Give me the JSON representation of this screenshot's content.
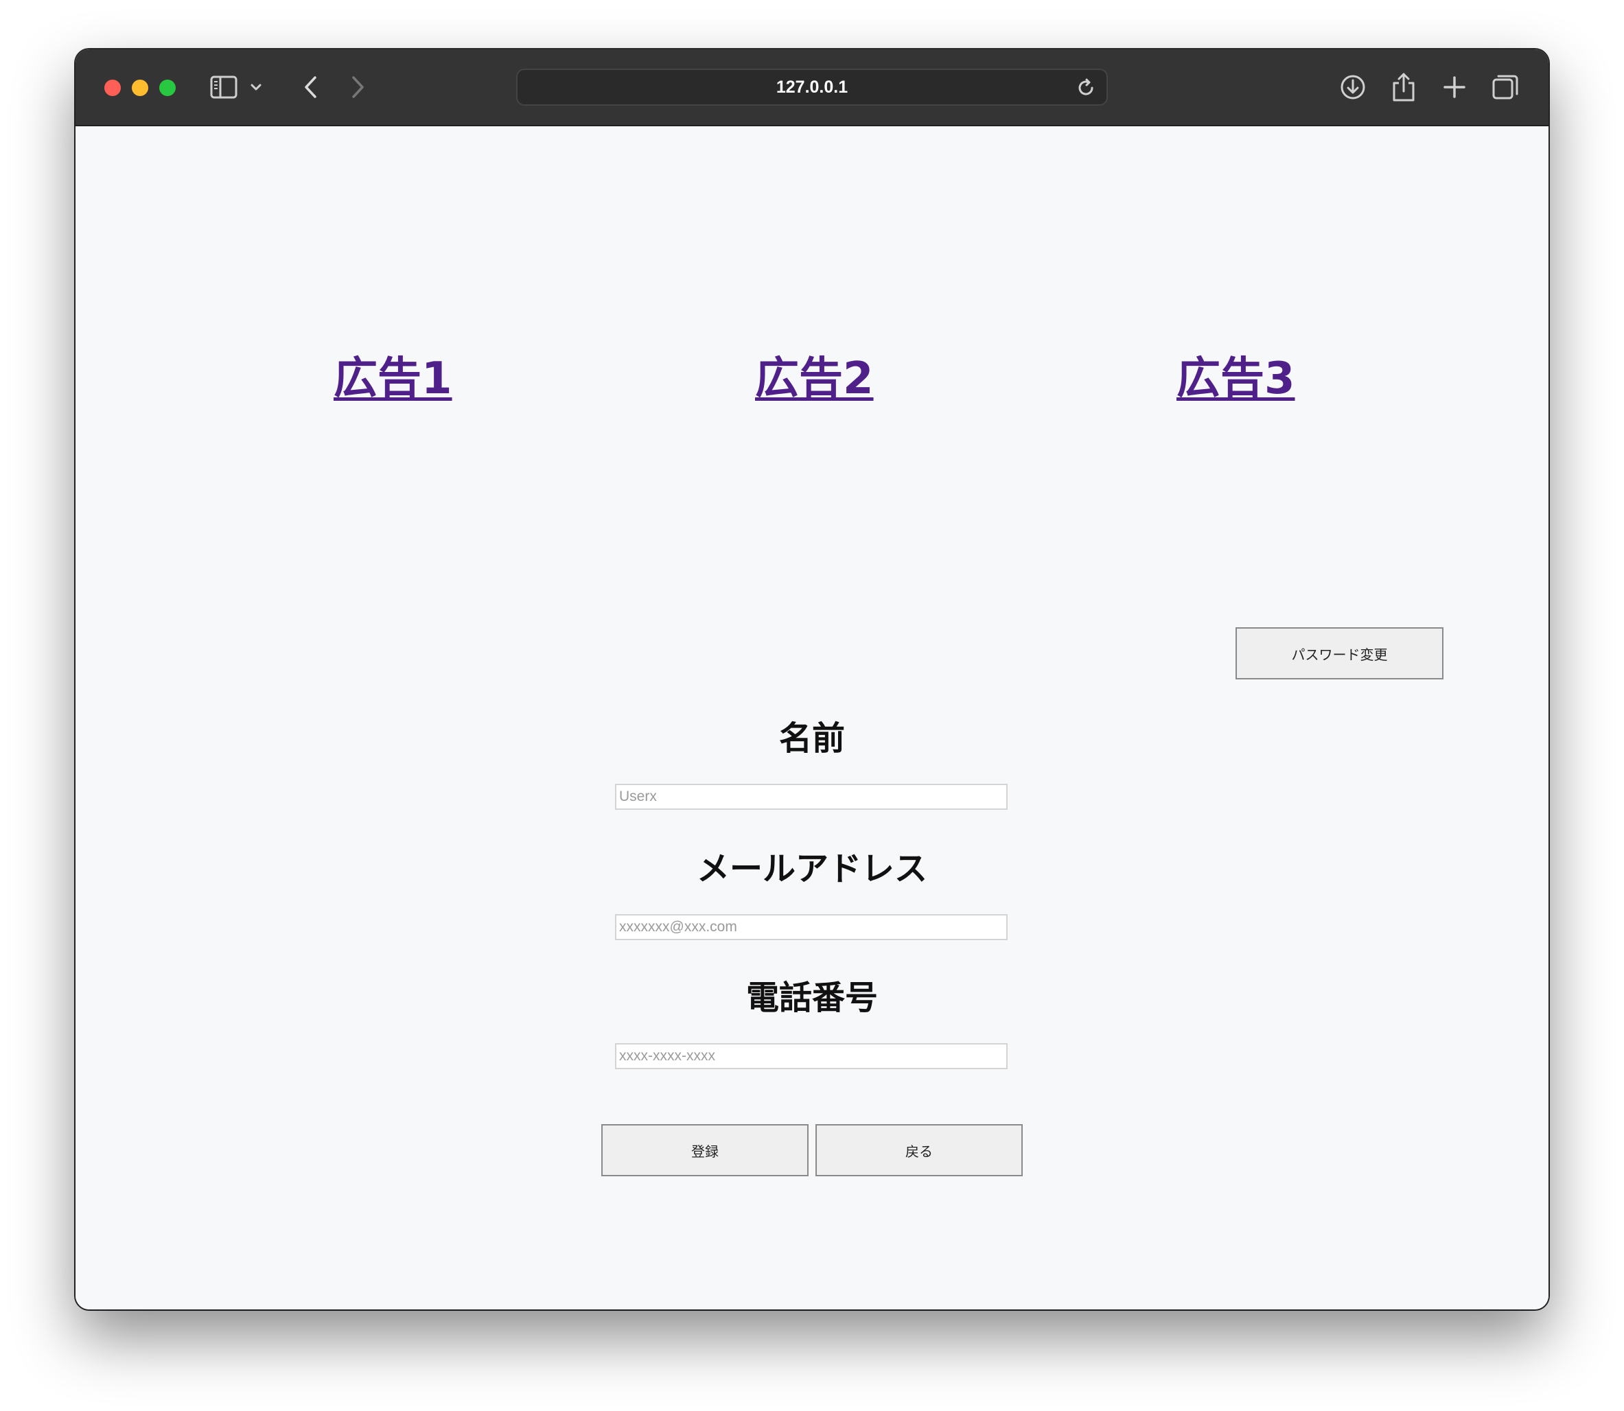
{
  "browser": {
    "url": "127.0.0.1",
    "icons": {
      "sidebar": "sidebar-icon",
      "chevron": "chevron-down-icon",
      "back": "back-arrow-icon",
      "forward": "forward-arrow-icon",
      "reload": "reload-icon",
      "download": "download-icon",
      "share": "share-icon",
      "new_tab": "plus-icon",
      "tabs": "tab-overview-icon"
    }
  },
  "ads": [
    {
      "label": "広告1"
    },
    {
      "label": "広告2"
    },
    {
      "label": "広告3"
    }
  ],
  "password_change_button": "パスワード変更",
  "form": {
    "name_label": "名前",
    "name_placeholder": "Userx",
    "email_label": "メールアドレス",
    "email_placeholder": "xxxxxxx@xxx.com",
    "phone_label": "電話番号",
    "phone_placeholder": "xxxx-xxxx-xxxx",
    "submit_label": "登録",
    "back_label": "戻る"
  },
  "colors": {
    "link": "#4f1f8a",
    "page_bg": "#f7f8fa",
    "titlebar_bg": "#343434"
  }
}
